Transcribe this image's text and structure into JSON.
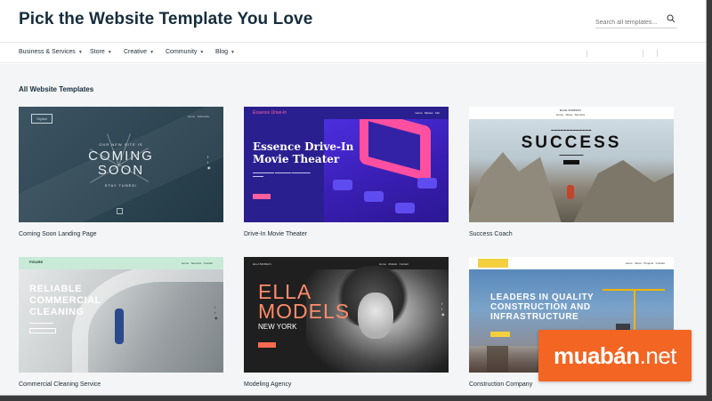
{
  "header": {
    "title": "Pick the Website Template You Love",
    "search_placeholder": "Search all templates..."
  },
  "nav": {
    "items": [
      {
        "label": "Business & Services"
      },
      {
        "label": "Store"
      },
      {
        "label": "Creative"
      },
      {
        "label": "Community"
      },
      {
        "label": "Blog"
      }
    ]
  },
  "main": {
    "section_title": "All Website Templates",
    "templates": [
      {
        "label": "Coming Soon Landing Page"
      },
      {
        "label": "Drive-In Movie Theater"
      },
      {
        "label": "Success Coach"
      },
      {
        "label": "Commercial Cleaning Service"
      },
      {
        "label": "Modeling Agency"
      },
      {
        "label": "Construction Company"
      }
    ]
  },
  "thumbs": {
    "coming_soon": {
      "small": "OUR NEW SITE IS",
      "big1": "COMING",
      "big2": "SOON",
      "tuned": "STAY TUNED!"
    },
    "drive_in": {
      "brand": "Essence Drive-In",
      "title": "Essence Drive-In Movie Theater"
    },
    "success": {
      "brand": "ELLIE JOHNSON",
      "big": "SUCCESS"
    },
    "cleaning": {
      "brand": "FIGURE",
      "title1": "RELIABLE",
      "title2": "COMMERCIAL",
      "title3": "CLEANING"
    },
    "models": {
      "brand": "ELLA MODELS",
      "title1": "ELLA",
      "title2": "MODELS",
      "city": "NEW YORK"
    },
    "construction": {
      "title1": "LEADERS IN QUALITY",
      "title2": "CONSTRUCTION AND",
      "title3": "INFRASTRUCTURE"
    }
  },
  "watermark": {
    "brand": "muabán",
    "suffix": ".net"
  },
  "colors": {
    "accent": "#f26522",
    "brand_title": "#162d3d"
  }
}
